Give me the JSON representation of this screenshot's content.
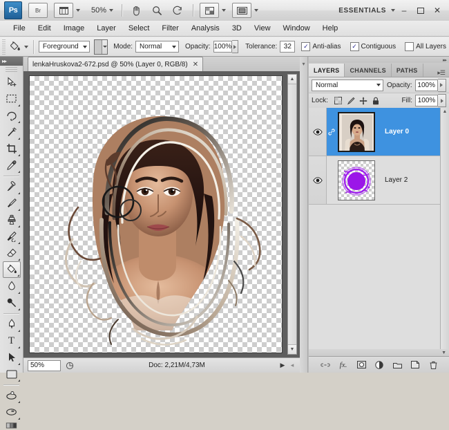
{
  "app": {
    "logo": "Ps",
    "bridge_label": "Br",
    "zoom_level": "50%",
    "workspace": "ESSENTIALS",
    "window_buttons": [
      "–",
      "❐",
      "✕"
    ]
  },
  "menubar": {
    "items": [
      "File",
      "Edit",
      "Image",
      "Layer",
      "Select",
      "Filter",
      "Analysis",
      "3D",
      "View",
      "Window",
      "Help"
    ]
  },
  "options_bar": {
    "tool_icon": "paint-bucket-icon",
    "fill_source": "Foreground",
    "mode_label": "Mode:",
    "mode_value": "Normal",
    "opacity_label": "Opacity:",
    "opacity_value": "100%",
    "tolerance_label": "Tolerance:",
    "tolerance_value": "32",
    "anti_alias_label": "Anti-alias",
    "anti_alias_checked": true,
    "contiguous_label": "Contiguous",
    "contiguous_checked": true,
    "all_layers_label": "All Layers",
    "all_layers_checked": false,
    "pattern_swatch_color": "#c9c9c9"
  },
  "toolbar": {
    "tools": [
      {
        "name": "move-tool",
        "selected": false,
        "has_flyout": false
      },
      {
        "name": "rectangular-marquee-tool",
        "selected": false,
        "has_flyout": true
      },
      {
        "name": "lasso-tool",
        "selected": false,
        "has_flyout": true
      },
      {
        "name": "magic-wand-tool",
        "selected": false,
        "has_flyout": true
      },
      {
        "name": "crop-tool",
        "selected": false,
        "has_flyout": true
      },
      {
        "name": "eyedropper-tool",
        "selected": false,
        "has_flyout": true
      },
      {
        "name": "healing-brush-tool",
        "selected": false,
        "has_flyout": true
      },
      {
        "name": "brush-tool",
        "selected": false,
        "has_flyout": true
      },
      {
        "name": "clone-stamp-tool",
        "selected": false,
        "has_flyout": true
      },
      {
        "name": "history-brush-tool",
        "selected": false,
        "has_flyout": true
      },
      {
        "name": "eraser-tool",
        "selected": false,
        "has_flyout": true
      },
      {
        "name": "paint-bucket-tool",
        "selected": true,
        "has_flyout": true
      },
      {
        "name": "blur-tool",
        "selected": false,
        "has_flyout": true
      },
      {
        "name": "dodge-tool",
        "selected": false,
        "has_flyout": true
      },
      {
        "name": "pen-tool",
        "selected": false,
        "has_flyout": true
      },
      {
        "name": "type-tool",
        "selected": false,
        "has_flyout": true
      },
      {
        "name": "path-selection-tool",
        "selected": false,
        "has_flyout": true
      },
      {
        "name": "rectangle-shape-tool",
        "selected": false,
        "has_flyout": true
      },
      {
        "name": "3d-rotate-tool",
        "selected": false,
        "has_flyout": true
      },
      {
        "name": "3d-orbit-tool",
        "selected": false,
        "has_flyout": true
      }
    ]
  },
  "document": {
    "tab_title": "lenkaHruskova2-672.psd @ 50% (Layer 0, RGB/8)",
    "close_label": "✕"
  },
  "status_bar": {
    "zoom": "50%",
    "doc_info": "Doc: 2,21M/4,73M",
    "play_arrow": "▶",
    "more_arrow": "◂"
  },
  "layers_panel": {
    "tabs": [
      {
        "label": "LAYERS",
        "active": true
      },
      {
        "label": "CHANNELS",
        "active": false
      },
      {
        "label": "PATHS",
        "active": false
      }
    ],
    "blend_mode": "Normal",
    "opacity_label": "Opacity:",
    "opacity_value": "100%",
    "lock_label": "Lock:",
    "fill_label": "Fill:",
    "fill_value": "100%",
    "lock_icons": [
      "lock-transparent-pixels-icon",
      "lock-image-pixels-icon",
      "lock-position-icon",
      "lock-all-icon"
    ],
    "layers": [
      {
        "name": "Layer 0",
        "selected": true,
        "visible": true,
        "thumb": "portrait-photo",
        "linked": true
      },
      {
        "name": "Layer 2",
        "selected": false,
        "visible": true,
        "thumb": "purple-circle",
        "linked": false
      }
    ],
    "footer_icons": [
      "link-layers-icon",
      "add-layer-style-icon",
      "add-layer-mask-icon",
      "new-fill-adjustment-layer-icon",
      "new-group-icon",
      "new-layer-icon",
      "delete-layer-icon"
    ],
    "footer_labels": [
      "",
      "fx.",
      "",
      "",
      "",
      "",
      ""
    ],
    "selection_color": "#3e92e0"
  },
  "colors": {
    "accent_blue": "#3e92e0",
    "chrome_light": "#e6e6e6",
    "chrome_dark": "#5e5e5e",
    "layer2_purple": "#9b16e8"
  }
}
